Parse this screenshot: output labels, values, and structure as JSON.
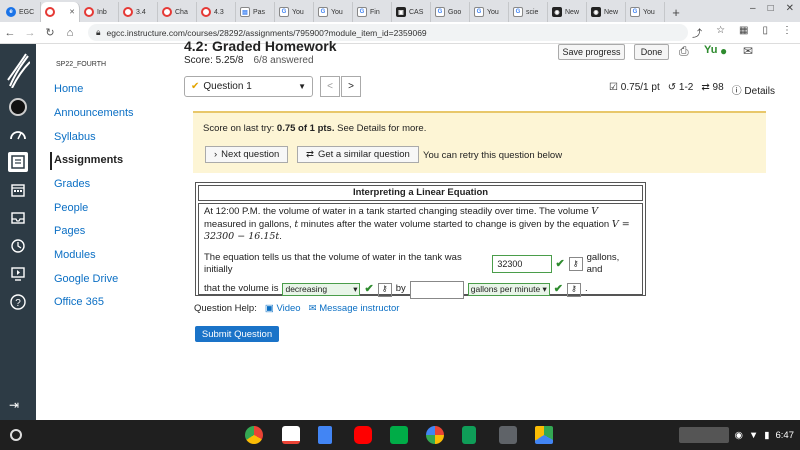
{
  "browser": {
    "tabs": [
      {
        "label": "EGC",
        "icon": "canvas-icon"
      },
      {
        "label": "",
        "icon": "canvas-icon"
      },
      {
        "label": "Inb",
        "icon": "canvas-icon"
      },
      {
        "label": "3.4",
        "icon": "canvas-icon"
      },
      {
        "label": "Cha",
        "icon": "canvas-icon"
      },
      {
        "label": "4.3",
        "icon": "canvas-icon"
      },
      {
        "label": "Pas",
        "icon": "doc-icon"
      },
      {
        "label": "You",
        "icon": "google-icon"
      },
      {
        "label": "You",
        "icon": "google-icon"
      },
      {
        "label": "Fin",
        "icon": "google-icon"
      },
      {
        "label": "CAS",
        "icon": "camera-icon"
      },
      {
        "label": "Goo",
        "icon": "google-icon"
      },
      {
        "label": "You",
        "icon": "google-icon"
      },
      {
        "label": "scie",
        "icon": "google-icon"
      },
      {
        "label": "New",
        "icon": "new-tab-icon"
      },
      {
        "label": "New",
        "icon": "new-tab-icon"
      },
      {
        "label": "You",
        "icon": "google-icon"
      }
    ],
    "url": "egcc.instructure.com/courses/28292/assignments/795900?module_item_id=2359069"
  },
  "coursenav": {
    "course_code": "SP22_FOURTH",
    "items": [
      "Home",
      "Announcements",
      "Syllabus",
      "Assignments",
      "Grades",
      "People",
      "Pages",
      "Modules",
      "Google Drive",
      "Office 365"
    ],
    "active": "Assignments"
  },
  "header": {
    "title": "4.2: Graded Homework",
    "score": "Score: 5.25/8",
    "answered": "6/8 answered",
    "save_label": "Save progress",
    "done_label": "Done"
  },
  "question_nav": {
    "selected": "Question 1",
    "prev": "<",
    "next": ">",
    "points": "0.75/1 pt",
    "retries": "1-2",
    "attempts": "98",
    "details": "Details"
  },
  "score_box": {
    "prefix": "Score on last try: ",
    "value": "0.75 of 1 pts.",
    "suffix": " See Details for more.",
    "next_label": "Next question",
    "similar_label": "Get a similar question",
    "retry_text": "You can retry this question below"
  },
  "question": {
    "heading": "Interpreting a Linear Equation",
    "intro_1": "At 12:00 P.M. the volume of water in a tank started changing steadily over time. The volume ",
    "var_v": "V",
    "intro_2": "measured in gallons, ",
    "var_t": "t",
    "intro_3": " minutes after the water volume started to change is given by the equation",
    "equation": "V = 32300 − 16.15t",
    "eq_end": ".",
    "line_a": "The equation tells us that the volume of water in the tank was initially",
    "answer_initial": "32300",
    "line_b": "gallons, and",
    "line_c": "that the volume is",
    "answer_direction": "decreasing",
    "line_d": "by",
    "answer_rate": "",
    "answer_unit": "gallons per minute",
    "line_e": "."
  },
  "help": {
    "label": "Question Help:",
    "video": "Video",
    "message": "Message instructor"
  },
  "submit_label": "Submit Question",
  "tray": {
    "time": "6:47"
  },
  "colors": {
    "canvas_nav": "#2d3b45",
    "link": "#0b6fc4",
    "submit": "#1a73c8",
    "correct": "#2e8b2e",
    "score_box_bg": "#fdf5d5"
  }
}
